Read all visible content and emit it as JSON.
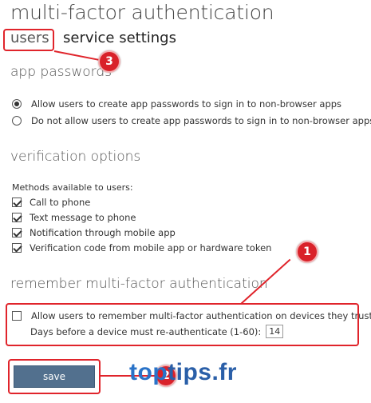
{
  "page": {
    "title": "multi-factor authentication",
    "tabs": [
      "users",
      "service settings"
    ]
  },
  "app_passwords": {
    "heading": "app passwords",
    "options": [
      {
        "label": "Allow users to create app passwords to sign in to non-browser apps",
        "selected": true
      },
      {
        "label": "Do not allow users to create app passwords to sign in to non-browser apps",
        "selected": false
      }
    ]
  },
  "verification": {
    "heading": "verification options",
    "methods_label": "Methods available to users:",
    "methods": [
      {
        "label": "Call to phone",
        "checked": true
      },
      {
        "label": "Text message to phone",
        "checked": true
      },
      {
        "label": "Notification through mobile app",
        "checked": true
      },
      {
        "label": "Verification code from mobile app or hardware token",
        "checked": true
      }
    ]
  },
  "remember": {
    "heading": "remember multi-factor authentication",
    "allow_label": "Allow users to remember multi-factor authentication on devices they trust",
    "allow_checked": false,
    "days_label": "Days before a device must re-authenticate (1-60):",
    "days_value": "14"
  },
  "actions": {
    "save_label": "save"
  },
  "annotations": {
    "badges": [
      "1",
      "2",
      "3"
    ],
    "color": "#e0242b"
  },
  "watermark": {
    "text_a": "top",
    "text_b": "tips.fr"
  }
}
